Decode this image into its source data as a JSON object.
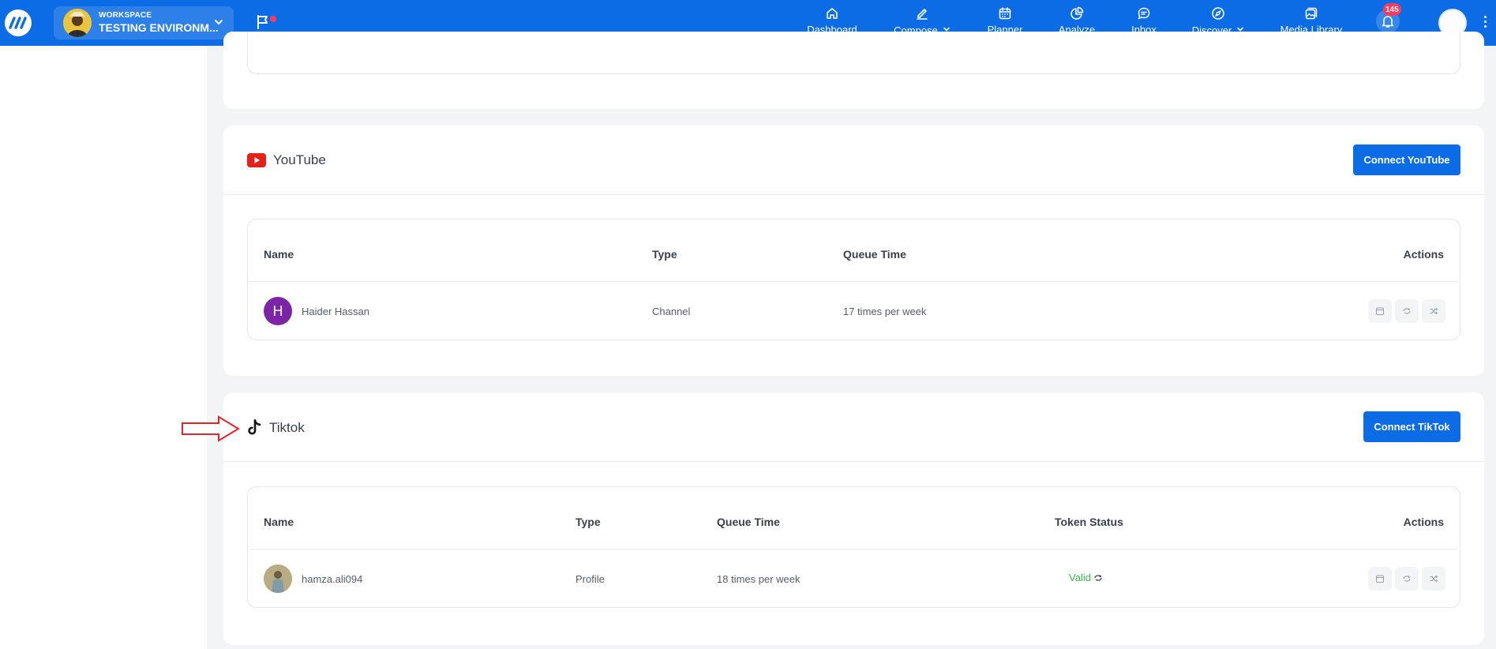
{
  "topbar": {
    "workspace_label": "WORKSPACE",
    "workspace_name": "TESTING ENVIRONM...",
    "nav": [
      {
        "label": "Dashboard",
        "icon": "home-icon"
      },
      {
        "label": "Compose",
        "icon": "edit-icon"
      },
      {
        "label": "Planner",
        "icon": "calendar-icon"
      },
      {
        "label": "Analyze",
        "icon": "pie-chart-icon"
      },
      {
        "label": "Inbox",
        "icon": "chat-icon"
      },
      {
        "label": "Discover",
        "icon": "compass-icon"
      },
      {
        "label": "Media Library",
        "icon": "image-icon"
      }
    ],
    "notification_count": "145"
  },
  "youtube": {
    "title": "YouTube",
    "connect_label": "Connect YouTube",
    "columns": {
      "name": "Name",
      "type": "Type",
      "queue": "Queue Time",
      "actions": "Actions"
    },
    "rows": [
      {
        "initial": "H",
        "name": "Haider Hassan",
        "type": "Channel",
        "queue": "17 times per week"
      }
    ]
  },
  "tiktok": {
    "title": "Tiktok",
    "connect_label": "Connect TikTok",
    "columns": {
      "name": "Name",
      "type": "Type",
      "queue": "Queue Time",
      "token": "Token Status",
      "actions": "Actions"
    },
    "rows": [
      {
        "name": "hamza.ali094",
        "type": "Profile",
        "queue": "18 times per week",
        "token_status": "Valid"
      }
    ]
  },
  "colors": {
    "primary": "#0c6ce6",
    "youtube_red": "#e62117",
    "avatar_purple": "#7b24a8",
    "valid_green": "#3bb54a",
    "arrow_red": "#e0252b"
  }
}
